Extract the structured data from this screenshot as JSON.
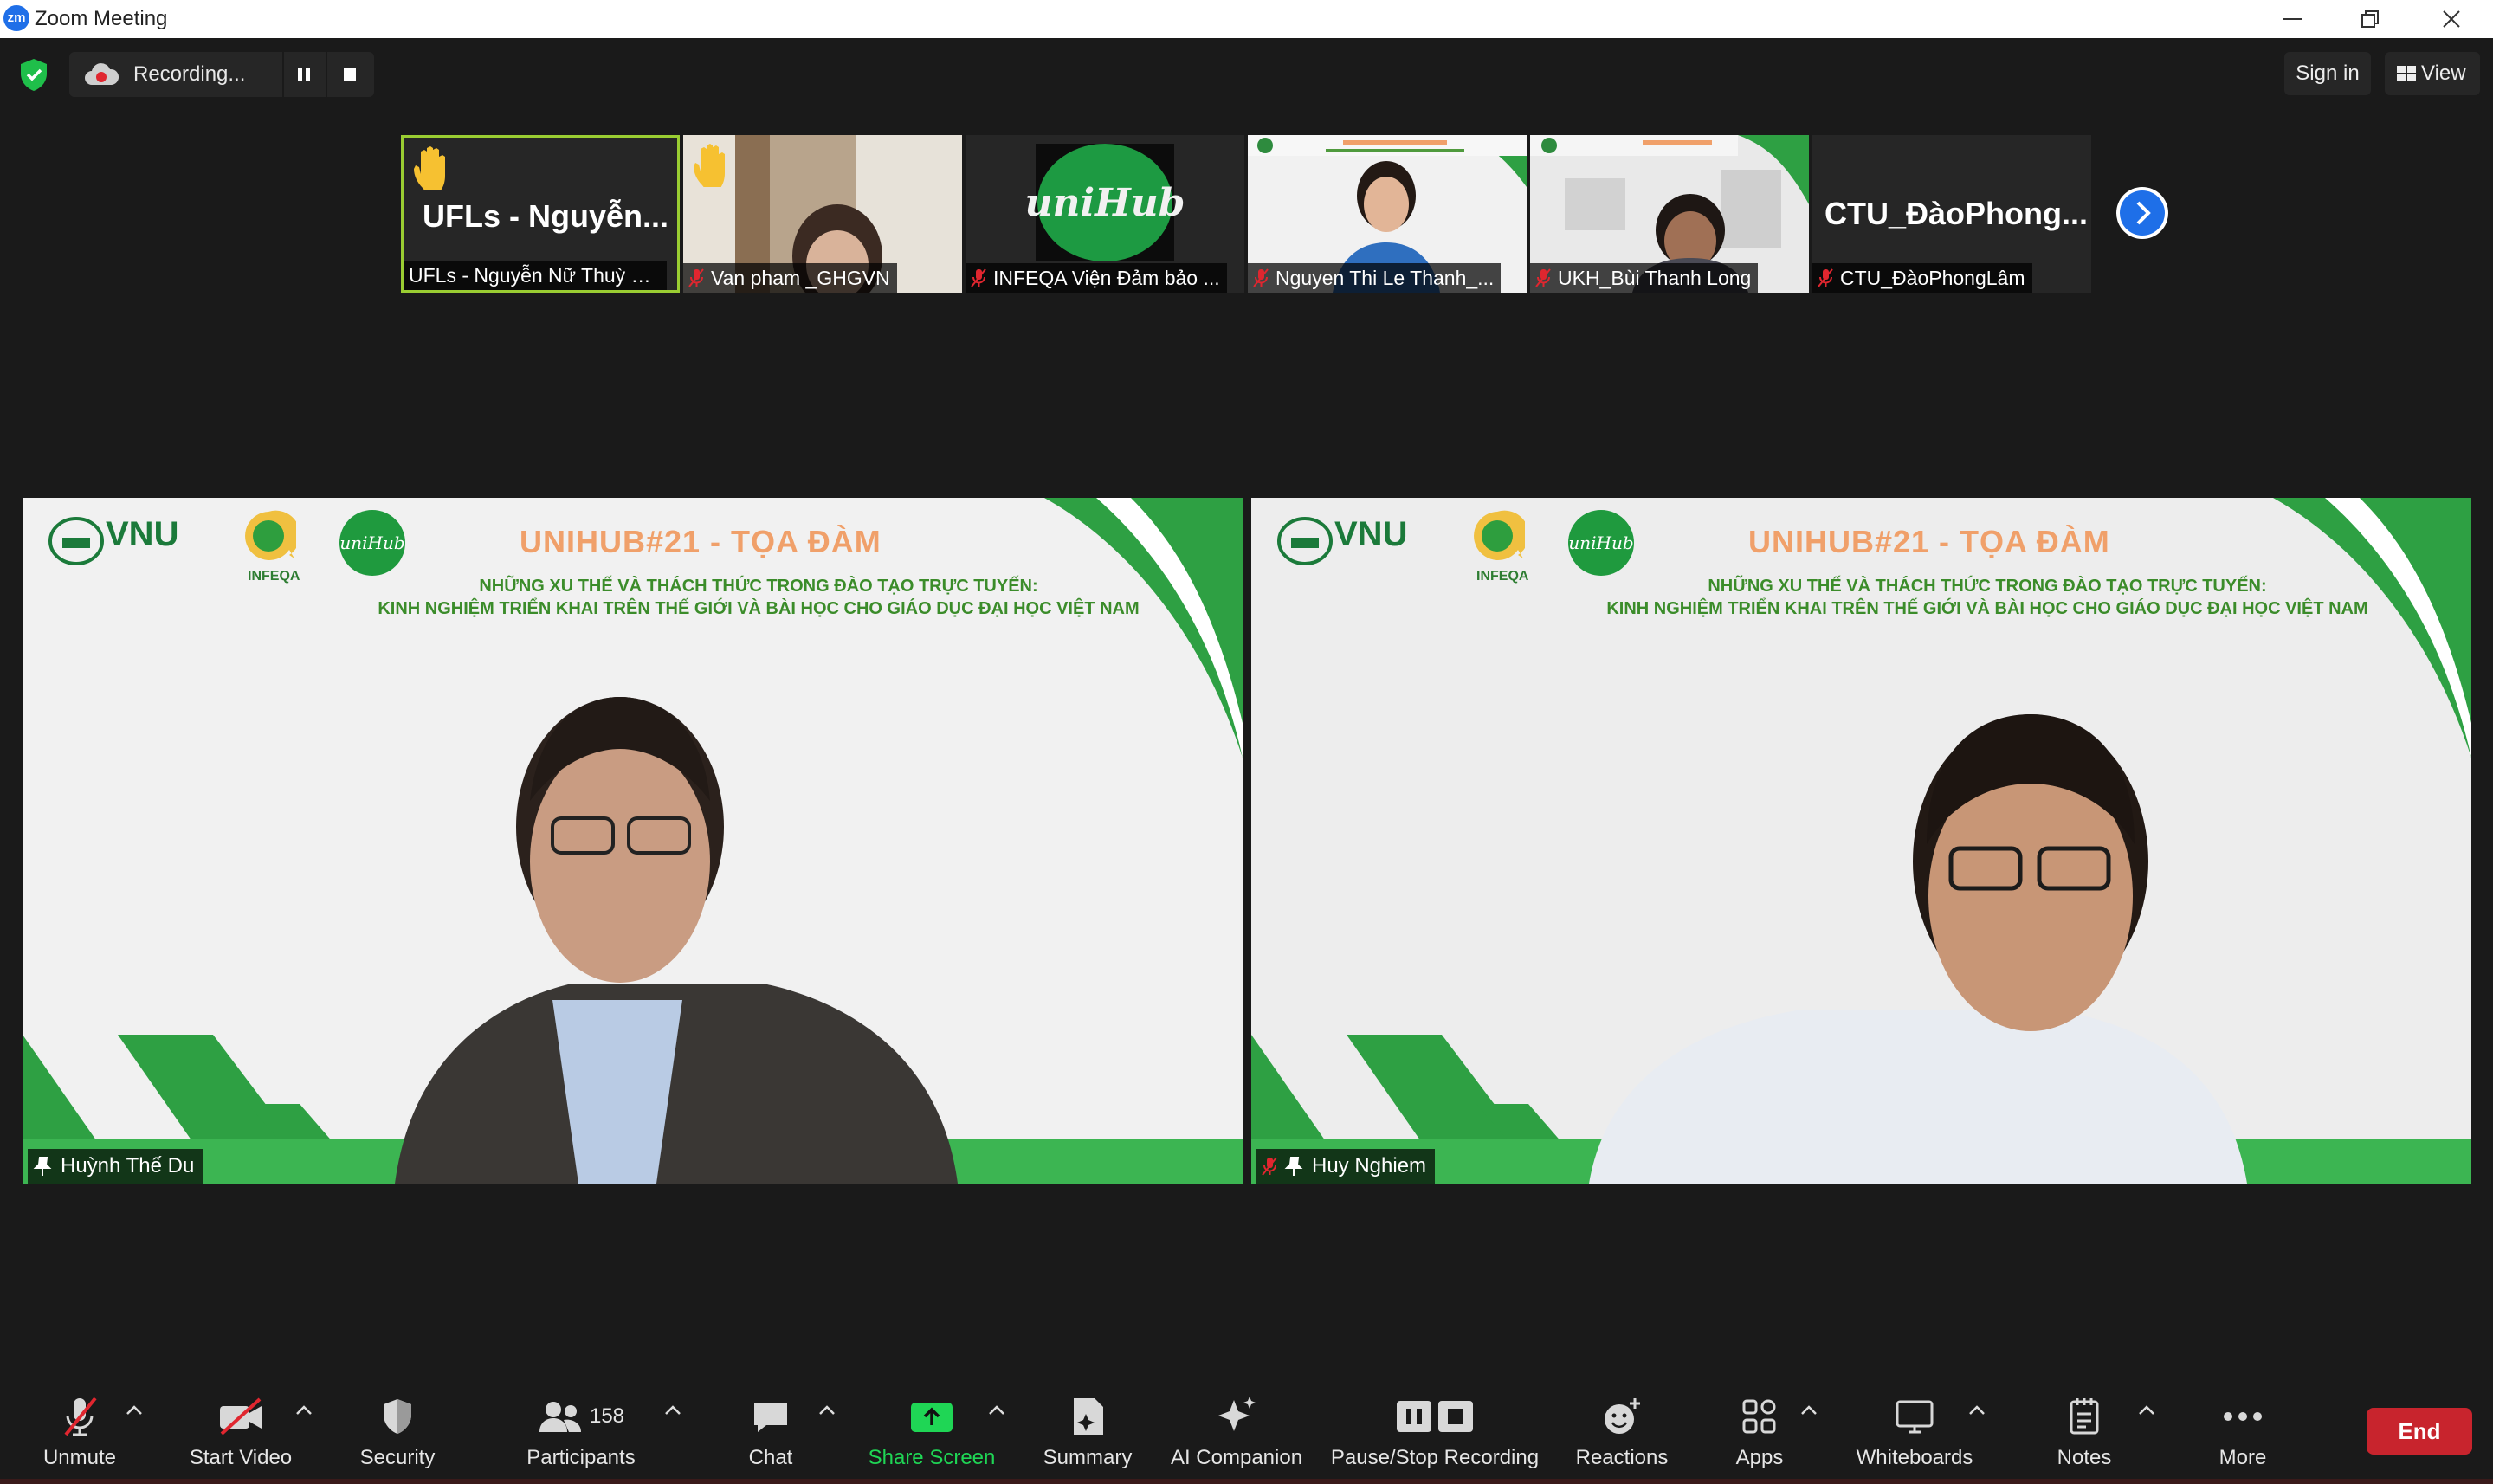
{
  "window": {
    "title": "Zoom Meeting",
    "app_icon_text": "zm"
  },
  "topbar": {
    "recording_label": "Recording...",
    "sign_in_label": "Sign in",
    "view_label": "View"
  },
  "thumbnails": [
    {
      "display": "UFLs - Nguyễn...",
      "name": "UFLs - Nguyễn Nữ Thuỳ U...",
      "hand_raised": true,
      "muted": false,
      "video": false
    },
    {
      "name": "Van pham _GHGVN",
      "hand_raised": true,
      "muted": true,
      "video": true
    },
    {
      "name": "INFEQA Viện Đảm bảo ...",
      "logo_text": "uniHub",
      "hand_raised": false,
      "muted": true,
      "video": true
    },
    {
      "name": "Nguyen Thi Le Thanh_...",
      "hand_raised": false,
      "muted": true,
      "video": true
    },
    {
      "name": "UKH_Bùi Thanh Long",
      "hand_raised": false,
      "muted": true,
      "video": true
    },
    {
      "display": "CTU_ĐàoPhong...",
      "name": "CTU_ĐàoPhongLâm",
      "hand_raised": false,
      "muted": true,
      "video": false
    }
  ],
  "videos": [
    {
      "name": "Huỳnh Thế Du",
      "pinned": true,
      "muted": false
    },
    {
      "name": "Huy Nghiem",
      "pinned": true,
      "muted": true
    }
  ],
  "banner": {
    "vnu": "VNU",
    "infeqa": "INFEQA",
    "unihub": "uniHub",
    "title": "UNIHUB#21 - TỌA ĐÀM",
    "line1": "NHỮNG XU THẾ VÀ THÁCH THỨC TRONG ĐÀO TẠO TRỰC TUYẾN:",
    "line2": "KINH NGHIỆM TRIỂN KHAI TRÊN THẾ GIỚI VÀ BÀI HỌC CHO GIÁO DỤC ĐẠI HỌC VIỆT NAM"
  },
  "toolbar": {
    "unmute": "Unmute",
    "start_video": "Start Video",
    "security": "Security",
    "participants": "Participants",
    "participant_count": "158",
    "chat": "Chat",
    "share_screen": "Share Screen",
    "summary": "Summary",
    "ai_companion": "AI Companion",
    "pause_stop_recording": "Pause/Stop Recording",
    "reactions": "Reactions",
    "apps": "Apps",
    "whiteboards": "Whiteboards",
    "notes": "Notes",
    "more": "More",
    "end": "End"
  },
  "colors": {
    "background": "#1a1a1a",
    "share_green": "#1fd655",
    "end_red": "#c8242d",
    "active_speaker_border": "#9acd32",
    "banner_green": "#2ea043",
    "banner_title_orange": "#f0a06a"
  }
}
